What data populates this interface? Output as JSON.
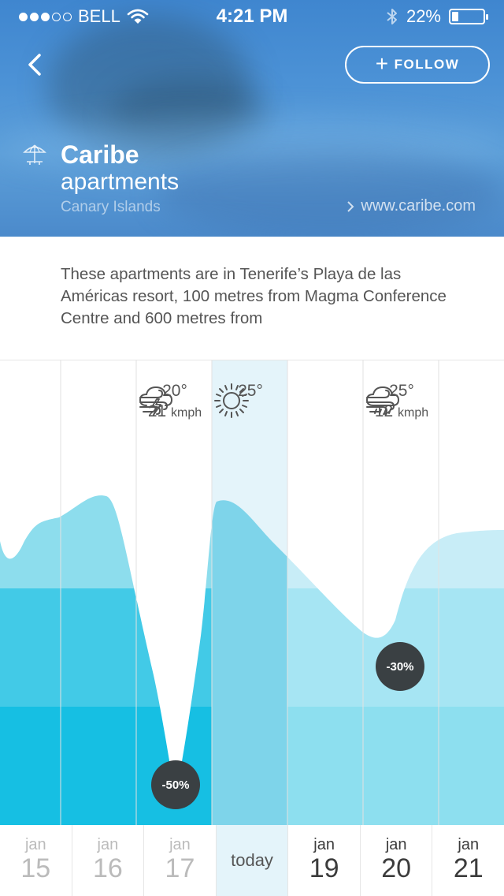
{
  "status_bar": {
    "signal_dots_filled": 3,
    "signal_dots_total": 5,
    "carrier": "BELL",
    "time": "4:21 PM",
    "battery_text": "22%",
    "battery_level": 0.22
  },
  "header": {
    "follow_label": "FOLLOW",
    "hotel_name": "Caribe",
    "hotel_type": "apartments",
    "location": "Canary Islands",
    "website": "www.caribe.com"
  },
  "description": "These apartments are in Tenerife’s Playa de las Américas resort, 100 metres from Magma Conference Centre and 600 metres from",
  "forecast": [
    {
      "icon": "thunderstorm-icon",
      "temp": "20°",
      "wind_speed": "21",
      "wind_unit": "kmph"
    },
    {
      "icon": "sun-icon",
      "temp": "25°"
    },
    {
      "icon": "rain-icon",
      "temp": "25°",
      "wind_speed": "12",
      "wind_unit": "kmph"
    }
  ],
  "badges": [
    "-50%",
    "-30%"
  ],
  "dates": [
    {
      "month": "jan",
      "day": "15"
    },
    {
      "month": "jan",
      "day": "16"
    },
    {
      "month": "jan",
      "day": "17"
    },
    {
      "label": "today"
    },
    {
      "month": "jan",
      "day": "19"
    },
    {
      "month": "jan",
      "day": "20"
    },
    {
      "month": "jan",
      "day": "21"
    }
  ],
  "colors": {
    "header_blue": "#4c92d6",
    "badge_dark": "#3a4043",
    "chart_light": "#a8e4f2",
    "chart_mid": "#3fc9e6",
    "chart_dark": "#15bde2",
    "today_highlight": "#e4f4fa"
  }
}
